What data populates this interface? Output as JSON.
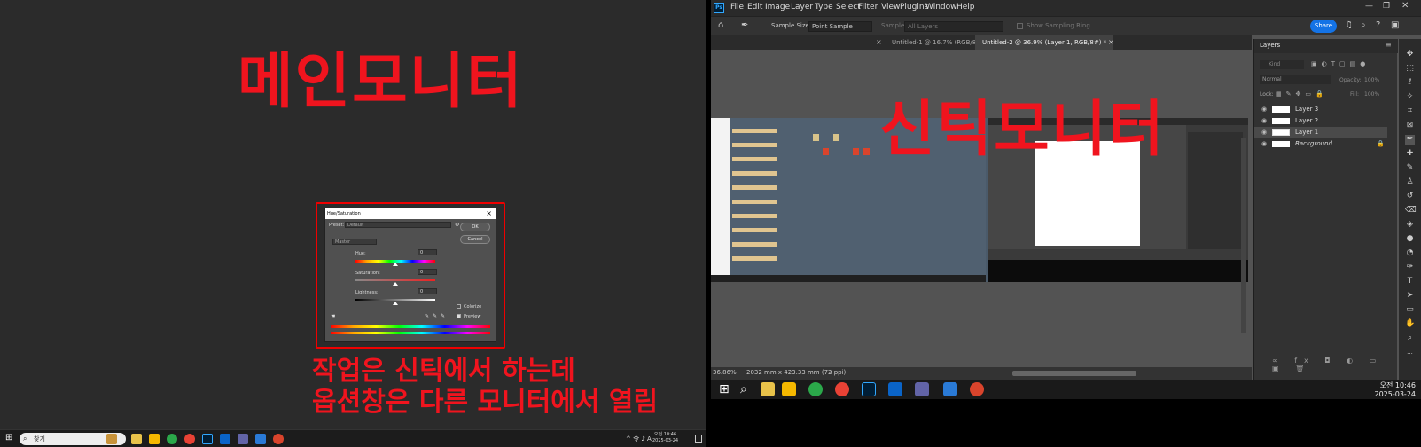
{
  "left_monitor": {
    "title": "메인모니터",
    "note_line1": "작업은 신틱에서 하는데",
    "note_line2": "옵션창은 다른 모니터에서 열림",
    "dialog": {
      "title": "Hue/Saturation",
      "preset_label": "Preset:",
      "preset_value": "Default",
      "ok_label": "OK",
      "cancel_label": "Cancel",
      "channel": "Master",
      "hue_label": "Hue:",
      "hue_value": "0",
      "saturation_label": "Saturation:",
      "saturation_value": "0",
      "lightness_label": "Lightness:",
      "lightness_value": "0",
      "colorize_label": "Colorize",
      "preview_label": "Preview"
    },
    "taskbar": {
      "search_placeholder": "찾기",
      "time": "오전 10:46",
      "date": "2025-03-24"
    }
  },
  "right_monitor": {
    "title": "신틱모니터",
    "menu": [
      "File",
      "Edit",
      "Image",
      "Layer",
      "Type",
      "Select",
      "Filter",
      "View",
      "Plugins",
      "Window",
      "Help"
    ],
    "options": {
      "sample_size_label": "Sample Size:",
      "sample_size_value": "Point Sample",
      "sample_label": "Sample:",
      "sample_value": "All Layers",
      "show_ring_label": "Show Sampling Ring",
      "share_label": "Share"
    },
    "tabs": [
      {
        "label": "Untitled-1 @ 16.7% (RGB/8)"
      },
      {
        "label": "Untitled-2 @ 36.9% (Layer 1, RGB/8#) *"
      }
    ],
    "status": {
      "zoom": "36.86%",
      "doc_size": "2032 mm x 423.33 mm (72 ppi)"
    },
    "layers_panel": {
      "title": "Layers",
      "kind_placeholder": "Kind",
      "blend_mode": "Normal",
      "opacity_label": "Opacity:",
      "opacity_value": "100%",
      "lock_label": "Lock:",
      "fill_label": "Fill:",
      "fill_value": "100%",
      "layers": [
        {
          "name": "Layer 3"
        },
        {
          "name": "Layer 2"
        },
        {
          "name": "Layer 1"
        },
        {
          "name": "Background"
        }
      ]
    },
    "taskbar": {
      "time": "오전 10:46",
      "date": "2025-03-24"
    }
  },
  "colors": {
    "annotation_red": "#f0141e",
    "ps_blue": "#31a8ff",
    "share_blue": "#1473e6"
  }
}
